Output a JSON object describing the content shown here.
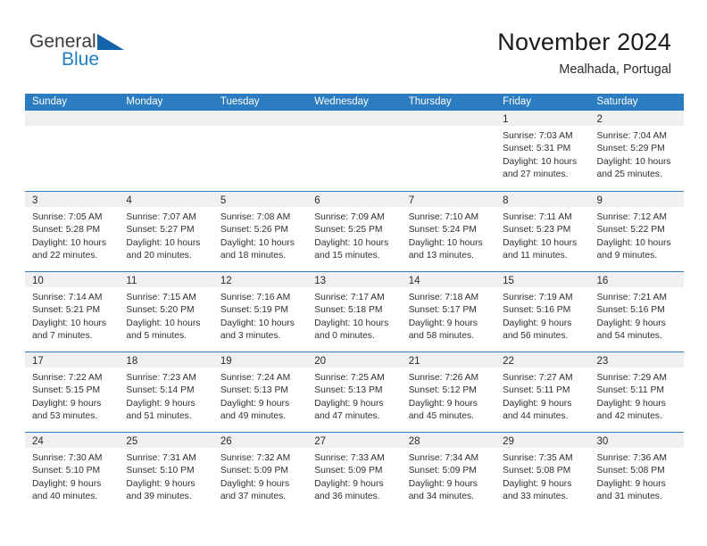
{
  "brand": {
    "name_top": "General",
    "name_bottom": "Blue",
    "accent_color": "#1f7fc4",
    "triangle_color": "#1265a8"
  },
  "header": {
    "title": "November 2024",
    "subtitle": "Mealhada, Portugal"
  },
  "calendar": {
    "header_bg": "#2b7cc0",
    "daynum_bg": "#f0f0f0",
    "weekdays": [
      "Sunday",
      "Monday",
      "Tuesday",
      "Wednesday",
      "Thursday",
      "Friday",
      "Saturday"
    ],
    "weeks": [
      [
        {
          "day": "",
          "lines": []
        },
        {
          "day": "",
          "lines": []
        },
        {
          "day": "",
          "lines": []
        },
        {
          "day": "",
          "lines": []
        },
        {
          "day": "",
          "lines": []
        },
        {
          "day": "1",
          "lines": [
            "Sunrise: 7:03 AM",
            "Sunset: 5:31 PM",
            "Daylight: 10 hours",
            "and 27 minutes."
          ]
        },
        {
          "day": "2",
          "lines": [
            "Sunrise: 7:04 AM",
            "Sunset: 5:29 PM",
            "Daylight: 10 hours",
            "and 25 minutes."
          ]
        }
      ],
      [
        {
          "day": "3",
          "lines": [
            "Sunrise: 7:05 AM",
            "Sunset: 5:28 PM",
            "Daylight: 10 hours",
            "and 22 minutes."
          ]
        },
        {
          "day": "4",
          "lines": [
            "Sunrise: 7:07 AM",
            "Sunset: 5:27 PM",
            "Daylight: 10 hours",
            "and 20 minutes."
          ]
        },
        {
          "day": "5",
          "lines": [
            "Sunrise: 7:08 AM",
            "Sunset: 5:26 PM",
            "Daylight: 10 hours",
            "and 18 minutes."
          ]
        },
        {
          "day": "6",
          "lines": [
            "Sunrise: 7:09 AM",
            "Sunset: 5:25 PM",
            "Daylight: 10 hours",
            "and 15 minutes."
          ]
        },
        {
          "day": "7",
          "lines": [
            "Sunrise: 7:10 AM",
            "Sunset: 5:24 PM",
            "Daylight: 10 hours",
            "and 13 minutes."
          ]
        },
        {
          "day": "8",
          "lines": [
            "Sunrise: 7:11 AM",
            "Sunset: 5:23 PM",
            "Daylight: 10 hours",
            "and 11 minutes."
          ]
        },
        {
          "day": "9",
          "lines": [
            "Sunrise: 7:12 AM",
            "Sunset: 5:22 PM",
            "Daylight: 10 hours",
            "and 9 minutes."
          ]
        }
      ],
      [
        {
          "day": "10",
          "lines": [
            "Sunrise: 7:14 AM",
            "Sunset: 5:21 PM",
            "Daylight: 10 hours",
            "and 7 minutes."
          ]
        },
        {
          "day": "11",
          "lines": [
            "Sunrise: 7:15 AM",
            "Sunset: 5:20 PM",
            "Daylight: 10 hours",
            "and 5 minutes."
          ]
        },
        {
          "day": "12",
          "lines": [
            "Sunrise: 7:16 AM",
            "Sunset: 5:19 PM",
            "Daylight: 10 hours",
            "and 3 minutes."
          ]
        },
        {
          "day": "13",
          "lines": [
            "Sunrise: 7:17 AM",
            "Sunset: 5:18 PM",
            "Daylight: 10 hours",
            "and 0 minutes."
          ]
        },
        {
          "day": "14",
          "lines": [
            "Sunrise: 7:18 AM",
            "Sunset: 5:17 PM",
            "Daylight: 9 hours",
            "and 58 minutes."
          ]
        },
        {
          "day": "15",
          "lines": [
            "Sunrise: 7:19 AM",
            "Sunset: 5:16 PM",
            "Daylight: 9 hours",
            "and 56 minutes."
          ]
        },
        {
          "day": "16",
          "lines": [
            "Sunrise: 7:21 AM",
            "Sunset: 5:16 PM",
            "Daylight: 9 hours",
            "and 54 minutes."
          ]
        }
      ],
      [
        {
          "day": "17",
          "lines": [
            "Sunrise: 7:22 AM",
            "Sunset: 5:15 PM",
            "Daylight: 9 hours",
            "and 53 minutes."
          ]
        },
        {
          "day": "18",
          "lines": [
            "Sunrise: 7:23 AM",
            "Sunset: 5:14 PM",
            "Daylight: 9 hours",
            "and 51 minutes."
          ]
        },
        {
          "day": "19",
          "lines": [
            "Sunrise: 7:24 AM",
            "Sunset: 5:13 PM",
            "Daylight: 9 hours",
            "and 49 minutes."
          ]
        },
        {
          "day": "20",
          "lines": [
            "Sunrise: 7:25 AM",
            "Sunset: 5:13 PM",
            "Daylight: 9 hours",
            "and 47 minutes."
          ]
        },
        {
          "day": "21",
          "lines": [
            "Sunrise: 7:26 AM",
            "Sunset: 5:12 PM",
            "Daylight: 9 hours",
            "and 45 minutes."
          ]
        },
        {
          "day": "22",
          "lines": [
            "Sunrise: 7:27 AM",
            "Sunset: 5:11 PM",
            "Daylight: 9 hours",
            "and 44 minutes."
          ]
        },
        {
          "day": "23",
          "lines": [
            "Sunrise: 7:29 AM",
            "Sunset: 5:11 PM",
            "Daylight: 9 hours",
            "and 42 minutes."
          ]
        }
      ],
      [
        {
          "day": "24",
          "lines": [
            "Sunrise: 7:30 AM",
            "Sunset: 5:10 PM",
            "Daylight: 9 hours",
            "and 40 minutes."
          ]
        },
        {
          "day": "25",
          "lines": [
            "Sunrise: 7:31 AM",
            "Sunset: 5:10 PM",
            "Daylight: 9 hours",
            "and 39 minutes."
          ]
        },
        {
          "day": "26",
          "lines": [
            "Sunrise: 7:32 AM",
            "Sunset: 5:09 PM",
            "Daylight: 9 hours",
            "and 37 minutes."
          ]
        },
        {
          "day": "27",
          "lines": [
            "Sunrise: 7:33 AM",
            "Sunset: 5:09 PM",
            "Daylight: 9 hours",
            "and 36 minutes."
          ]
        },
        {
          "day": "28",
          "lines": [
            "Sunrise: 7:34 AM",
            "Sunset: 5:09 PM",
            "Daylight: 9 hours",
            "and 34 minutes."
          ]
        },
        {
          "day": "29",
          "lines": [
            "Sunrise: 7:35 AM",
            "Sunset: 5:08 PM",
            "Daylight: 9 hours",
            "and 33 minutes."
          ]
        },
        {
          "day": "30",
          "lines": [
            "Sunrise: 7:36 AM",
            "Sunset: 5:08 PM",
            "Daylight: 9 hours",
            "and 31 minutes."
          ]
        }
      ]
    ]
  }
}
